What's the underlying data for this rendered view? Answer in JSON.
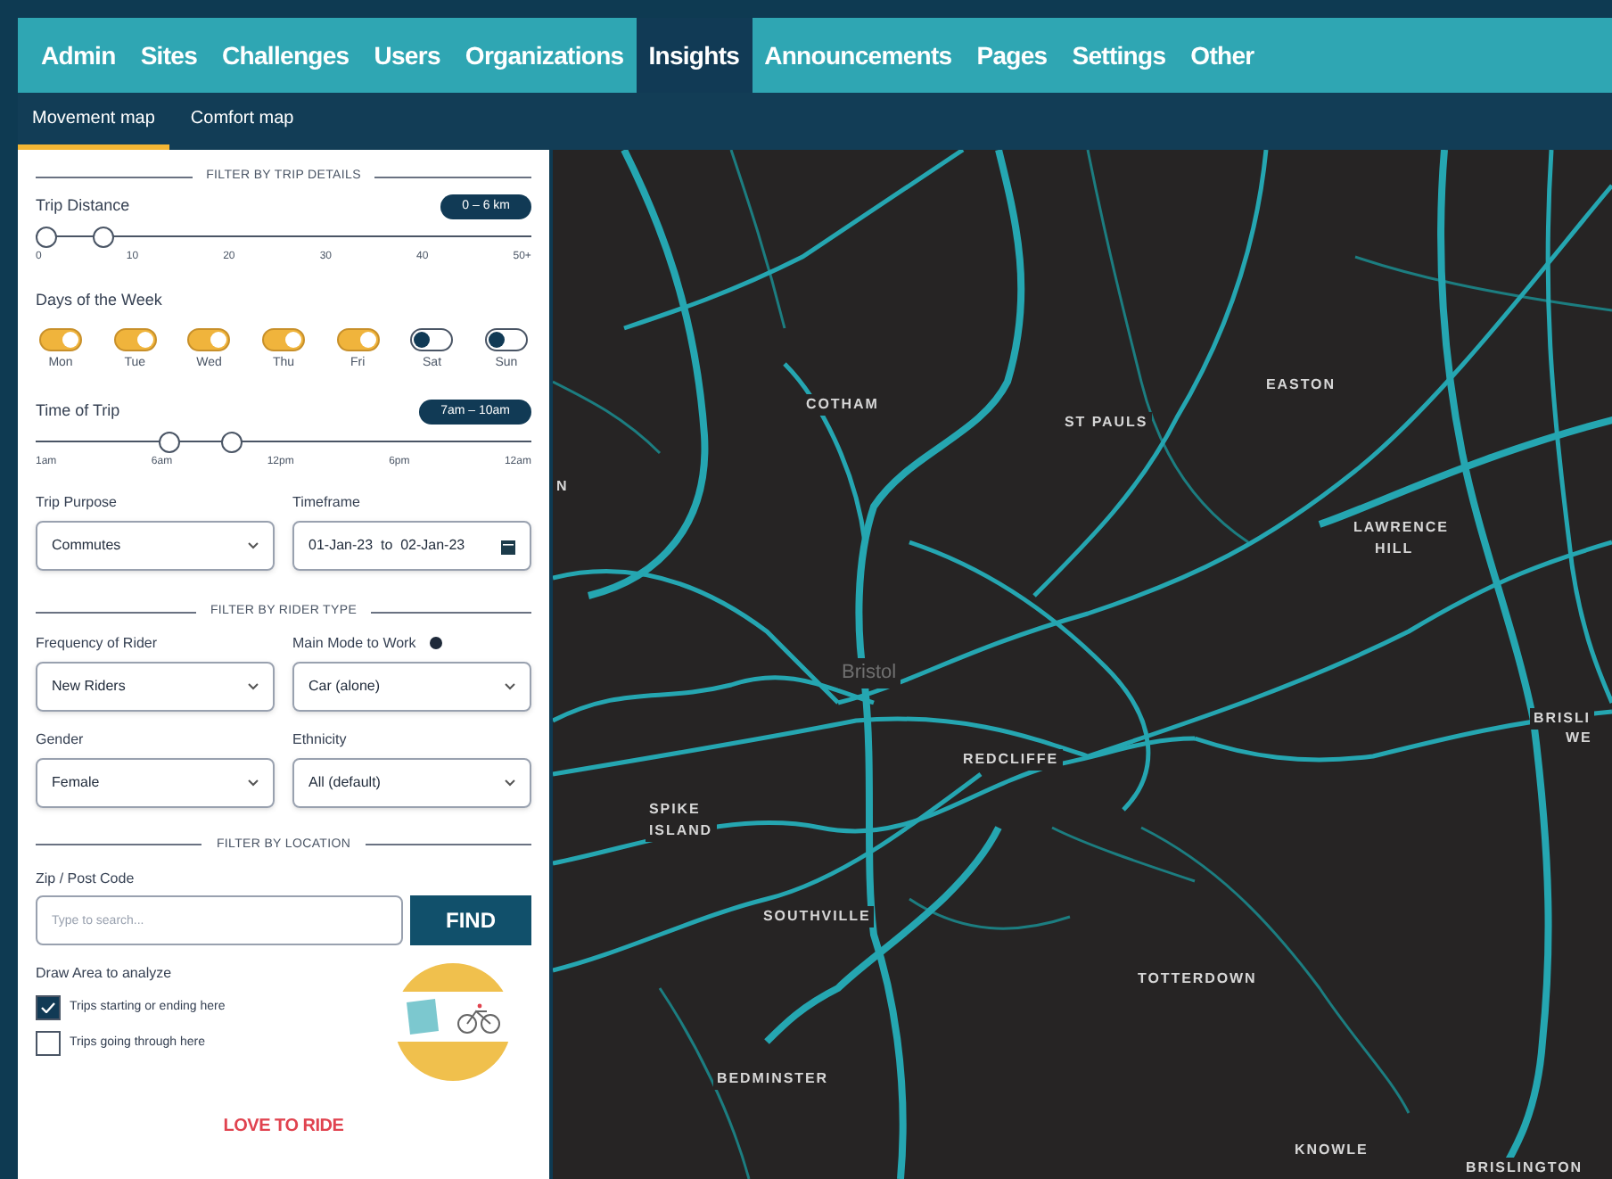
{
  "nav": {
    "tabs": [
      {
        "label": "Admin",
        "selected": false
      },
      {
        "label": "Sites",
        "selected": false
      },
      {
        "label": "Challenges",
        "selected": false
      },
      {
        "label": "Users",
        "selected": false
      },
      {
        "label": "Organizations",
        "selected": false
      },
      {
        "label": "Insights",
        "selected": true
      },
      {
        "label": "Announcements",
        "selected": false
      },
      {
        "label": "Pages",
        "selected": false
      },
      {
        "label": "Settings",
        "selected": false
      },
      {
        "label": "Other",
        "selected": false
      }
    ]
  },
  "subnav": {
    "tabs": [
      {
        "label": "Movement map",
        "selected": true
      },
      {
        "label": "Comfort map",
        "selected": false
      }
    ]
  },
  "trip_details": {
    "heading": "FILTER BY TRIP DETAILS",
    "distance": {
      "label": "Trip Distance",
      "badge": "0 – 6 km",
      "thumbs": [
        {
          "level": 0
        },
        {
          "level": 0.12
        }
      ],
      "ticks": [
        "0",
        "10",
        "20",
        "30",
        "40",
        "50+"
      ]
    },
    "days": {
      "label": "Days of the Week",
      "items": [
        {
          "label": "Mon",
          "on": true
        },
        {
          "label": "Tue",
          "on": true
        },
        {
          "label": "Wed",
          "on": true
        },
        {
          "label": "Thu",
          "on": true
        },
        {
          "label": "Fri",
          "on": true
        },
        {
          "label": "Sat",
          "on": false
        },
        {
          "label": "Sun",
          "on": false
        }
      ]
    },
    "time": {
      "label": "Time of Trip",
      "badge": "7am – 10am",
      "thumbs": [
        {
          "level": 0.26
        },
        {
          "level": 0.39
        }
      ],
      "ticks": [
        "1am",
        "6am",
        "12pm",
        "6pm",
        "12am"
      ]
    },
    "selects": [
      {
        "label": "Trip Purpose",
        "value": "Commutes",
        "kind": "dropdown"
      },
      {
        "label": "Timeframe",
        "value": "01-Jan-23  to  02-Jan-23",
        "kind": "date"
      }
    ]
  },
  "rider_type": {
    "heading": "FILTER BY RIDER TYPE",
    "selects": [
      {
        "label": "Frequency of Rider",
        "value": "New Riders",
        "kind": "dropdown"
      },
      {
        "label": "Main Mode to Work",
        "value": "Car (alone)",
        "kind": "dropdown",
        "info": true
      },
      {
        "label": "Gender",
        "value": "Female",
        "kind": "dropdown"
      },
      {
        "label": "Ethnicity",
        "value": "All (default)",
        "kind": "dropdown"
      }
    ]
  },
  "location": {
    "heading": "FILTER BY LOCATION",
    "zip": {
      "label": "Zip / Post Code",
      "placeholder": "Type to search...",
      "button": "FIND"
    },
    "draw_area": {
      "label": "Draw Area to analyze",
      "options": [
        {
          "label": "Trips starting or ending here",
          "checked": true
        },
        {
          "label": "Trips going through here",
          "checked": false
        }
      ]
    }
  },
  "logo": "LOVE TO RIDE",
  "map": {
    "labels": [
      "COTHAM",
      "ST PAULS",
      "EASTON",
      "LAWRENCE",
      "HILL",
      "Bristol",
      "REDCLIFFE",
      "SPIKE",
      "ISLAND",
      "BRISLI",
      "WE",
      "N",
      "SOUTHVILLE",
      "TOTTERDOWN",
      "BEDMINSTER",
      "KNOWLE",
      "BRISLINGTON"
    ]
  }
}
